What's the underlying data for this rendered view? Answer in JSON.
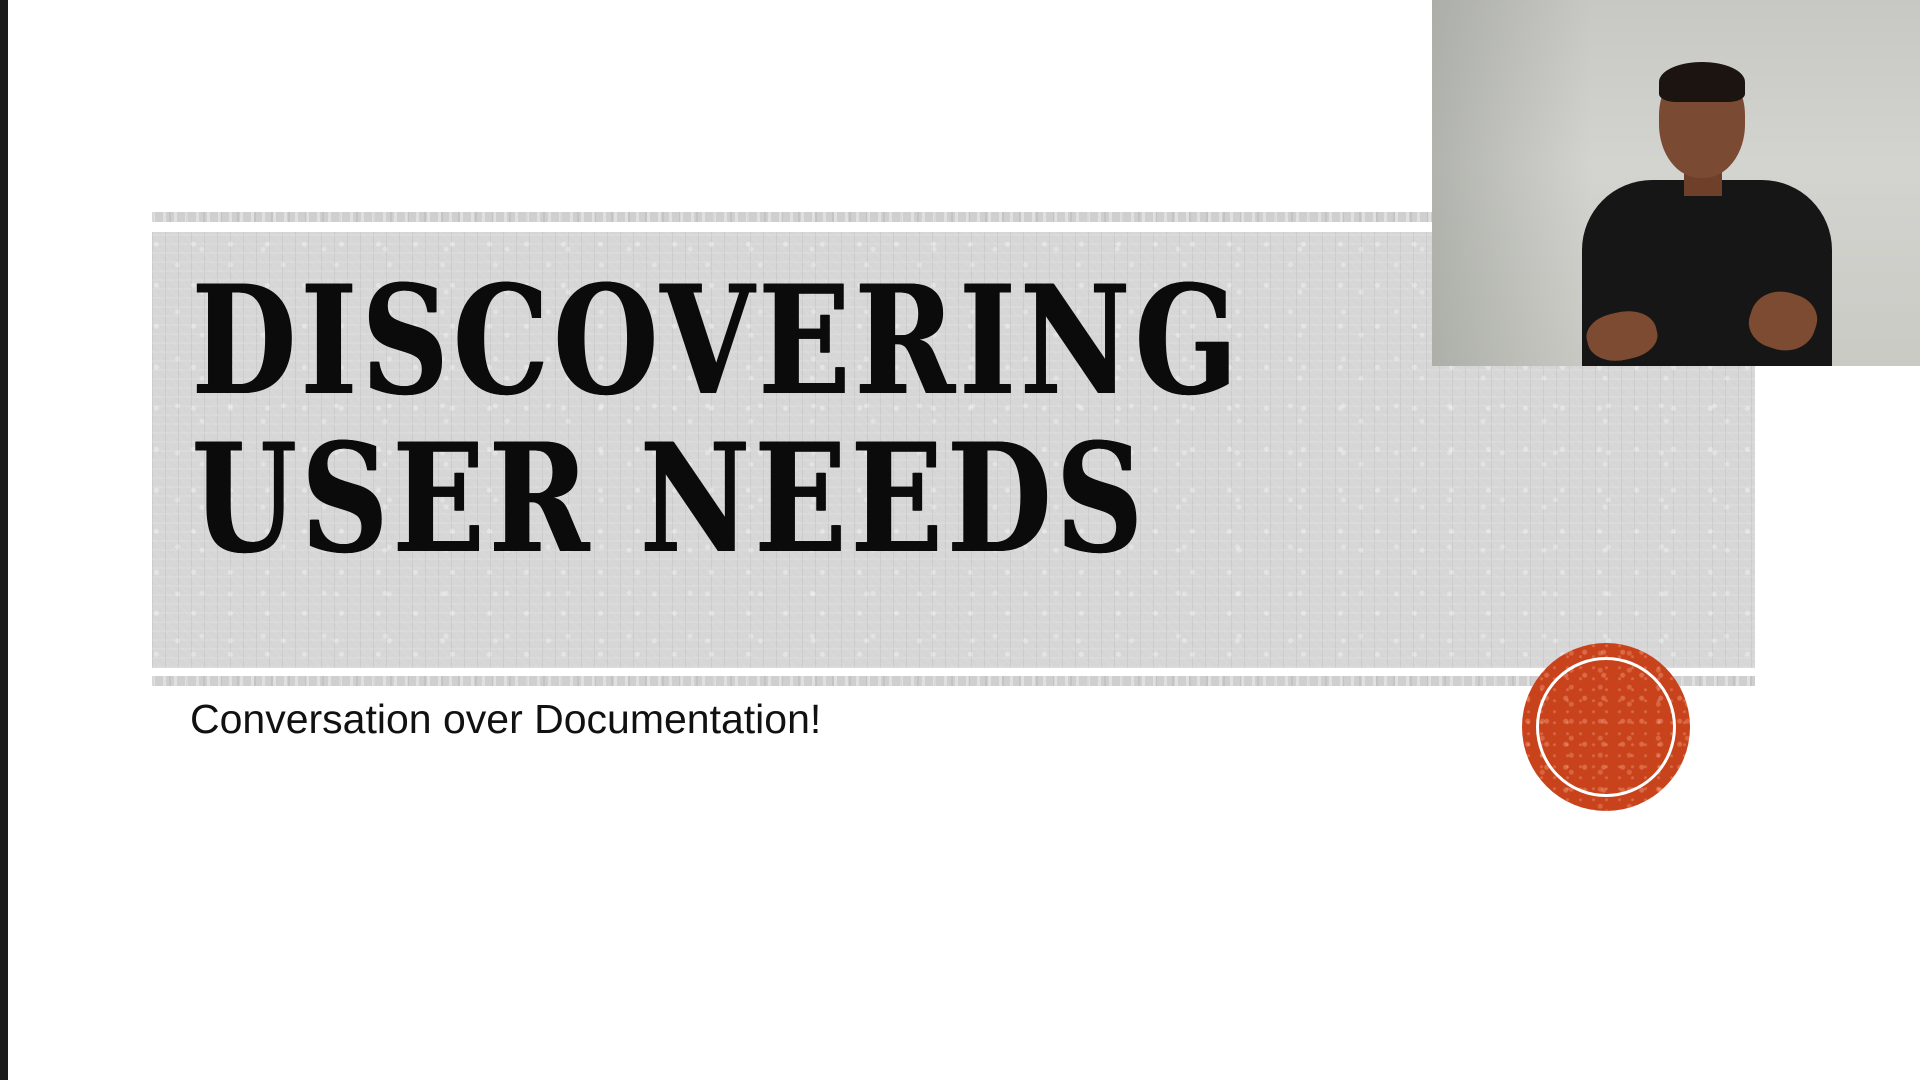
{
  "slide": {
    "title": "DISCOVERING USER NEEDS",
    "subtitle": "Conversation over Documentation!"
  },
  "decor": {
    "accent_circle_color": "#c8421b",
    "title_band_color": "#d6d6d6"
  },
  "webcam": {
    "description_icon": "presenter-video-feed"
  }
}
